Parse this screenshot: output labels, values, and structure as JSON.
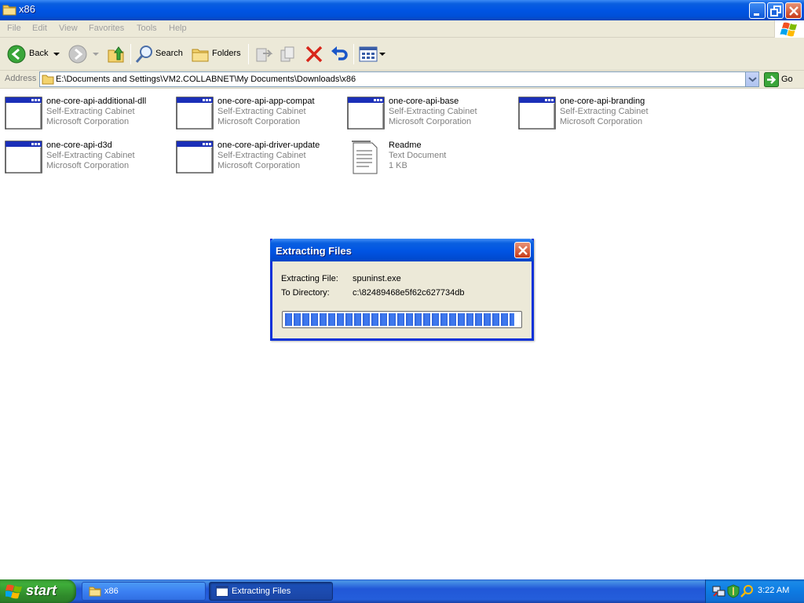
{
  "window": {
    "title": "x86"
  },
  "menu": [
    "File",
    "Edit",
    "View",
    "Favorites",
    "Tools",
    "Help"
  ],
  "toolbar": {
    "back_label": "Back",
    "search_label": "Search",
    "folders_label": "Folders"
  },
  "address": {
    "label": "Address",
    "value": "E:\\Documents and Settings\\VM2.COLLABNET\\My Documents\\Downloads\\x86",
    "go_label": "Go"
  },
  "files": [
    {
      "name": "one-core-api-additional-dll",
      "type": "Self-Extracting Cabinet",
      "company": "Microsoft Corporation",
      "icon": "cabinet-window-icon"
    },
    {
      "name": "one-core-api-app-compat",
      "type": "Self-Extracting Cabinet",
      "company": "Microsoft Corporation",
      "icon": "cabinet-window-icon"
    },
    {
      "name": "one-core-api-base",
      "type": "Self-Extracting Cabinet",
      "company": "Microsoft Corporation",
      "icon": "cabinet-window-icon"
    },
    {
      "name": "one-core-api-branding",
      "type": "Self-Extracting Cabinet",
      "company": "Microsoft Corporation",
      "icon": "cabinet-window-icon"
    },
    {
      "name": "one-core-api-d3d",
      "type": "Self-Extracting Cabinet",
      "company": "Microsoft Corporation",
      "icon": "cabinet-window-icon"
    },
    {
      "name": "one-core-api-driver-update",
      "type": "Self-Extracting Cabinet",
      "company": "Microsoft Corporation",
      "icon": "cabinet-window-icon"
    },
    {
      "name": "Readme",
      "type": "Text Document",
      "company": "1 KB",
      "icon": "text-document-icon"
    }
  ],
  "dialog": {
    "title": "Extracting Files",
    "file_label": "Extracting File:",
    "file_value": "spuninst.exe",
    "dir_label": "To Directory:",
    "dir_value": "c:\\82489468e5f62c627734db",
    "progress": 0.98
  },
  "taskbar": {
    "start_label": "start",
    "tasks": [
      {
        "label": "x86",
        "icon": "folder-icon",
        "active": false
      },
      {
        "label": "Extracting Files",
        "icon": "window-icon",
        "active": true
      }
    ],
    "clock": "3:22 AM"
  },
  "colors": {
    "title_blue": "#0054e3",
    "chrome": "#ece9d8",
    "start_green": "#3fae3a",
    "close_red": "#c73a17"
  }
}
